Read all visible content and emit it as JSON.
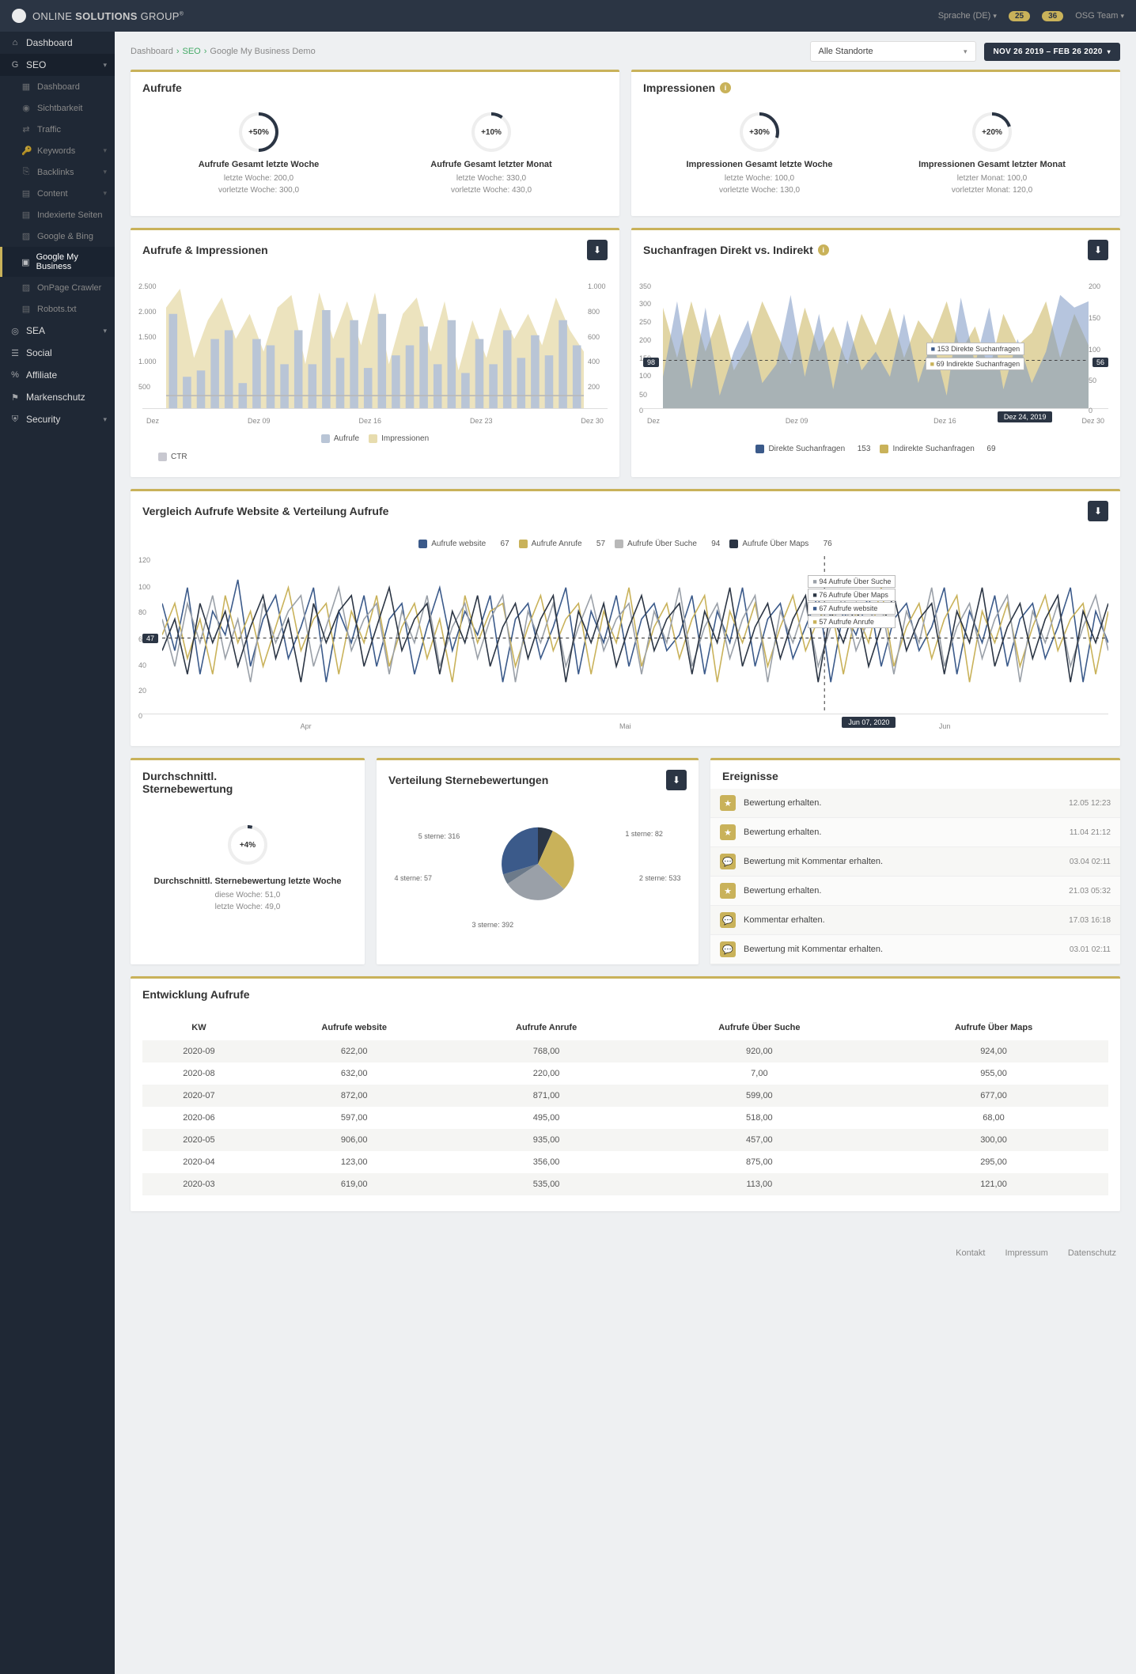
{
  "brand": {
    "name_pre": "ONLINE ",
    "name_bold": "SOLUTIONS ",
    "name_post": "GROUP",
    "reg": "®"
  },
  "topbar": {
    "lang": "Sprache (DE)",
    "badge1": "25",
    "badge2": "36",
    "user": "OSG Team"
  },
  "sidebar": {
    "dashboard": "Dashboard",
    "seo": "SEO",
    "seo_items": [
      "Dashboard",
      "Sichtbarkeit",
      "Traffic",
      "Keywords",
      "Backlinks",
      "Content",
      "Indexierte Seiten",
      "Google & Bing",
      "Google My Business",
      "OnPage Crawler",
      "Robots.txt"
    ],
    "sea": "SEA",
    "social": "Social",
    "affiliate": "Affiliate",
    "marken": "Markenschutz",
    "security": "Security"
  },
  "breadcrumb": {
    "a": "Dashboard",
    "b": "SEO",
    "c": "Google My Business Demo"
  },
  "loc_select": "Alle Standorte",
  "date_range": "NOV 26 2019 – FEB 26 2020",
  "card_aufrufe": {
    "title": "Aufrufe",
    "k1": {
      "pct": "+50%",
      "title": "Aufrufe Gesamt letzte Woche",
      "l1": "letzte Woche: 200,0",
      "l2": "vorletzte Woche: 300,0"
    },
    "k2": {
      "pct": "+10%",
      "title": "Aufrufe Gesamt letzter Monat",
      "l1": "letzte Woche: 330,0",
      "l2": "vorletzte Woche: 430,0"
    }
  },
  "card_impr": {
    "title": "Impressionen",
    "k1": {
      "pct": "+30%",
      "title": "Impressionen Gesamt letzte Woche",
      "l1": "letzte Woche: 100,0",
      "l2": "vorletzte Woche: 130,0"
    },
    "k2": {
      "pct": "+20%",
      "title": "Impressionen Gesamt letzter Monat",
      "l1": "letzter Monat: 100,0",
      "l2": "vorletzter Monat: 120,0"
    }
  },
  "card_ai": {
    "title": "Aufrufe & Impressionen",
    "legend": {
      "a": "Aufrufe",
      "b": "Impressionen",
      "c": "CTR"
    },
    "xticks": [
      "Dez",
      "Dez 09",
      "Dez 16",
      "Dez 23",
      "Dez 30"
    ]
  },
  "card_such": {
    "title": "Suchanfragen Direkt vs. Indirekt",
    "tt1": "153 Direkte Suchanfragen",
    "tt2": "69 Indirekte Suchanfragen",
    "lbadge": "98",
    "rbadge": "56",
    "datebadge": "Dez 24, 2019",
    "legend": {
      "a": "Direkte Suchanfragen",
      "av": "153",
      "b": "Indirekte Suchanfragen",
      "bv": "69"
    },
    "xticks": [
      "Dez",
      "Dez 09",
      "Dez 16",
      "Dez 30"
    ]
  },
  "card_vgl": {
    "title": "Vergleich Aufrufe Website & Verteilung Aufrufe",
    "legend": {
      "a": "Aufrufe website",
      "av": "67",
      "b": "Aufrufe Anrufe",
      "bv": "57",
      "c": "Aufrufe Über Suche",
      "cv": "94",
      "d": "Aufrufe Über Maps",
      "dv": "76"
    },
    "tt": [
      "94 Aufrufe Über Suche",
      "76 Aufrufe Über Maps",
      "67 Aufrufe website",
      "57 Aufrufe Anrufe"
    ],
    "lbadge": "47",
    "datebadge": "Jun 07, 2020",
    "xticks": [
      "Apr",
      "Mai",
      "Jun"
    ]
  },
  "card_durch": {
    "title1": "Durchschnittl.",
    "title2": "Sternebewertung",
    "pct": "+4%",
    "sub_title": "Durchschnittl. Sternebewertung letzte Woche",
    "l1": "diese Woche: 51,0",
    "l2": "letzte Woche: 49,0"
  },
  "card_pie": {
    "title": "Verteilung Sternebewertungen",
    "labels": {
      "s1": "1 sterne: 82",
      "s2": "2 sterne: 533",
      "s3": "3 sterne: 392",
      "s4": "4 sterne: 57",
      "s5": "5 sterne: 316"
    }
  },
  "card_events": {
    "title": "Ereignisse",
    "rows": [
      {
        "ico": "star",
        "txt": "Bewertung erhalten.",
        "ts": "12.05 12:23"
      },
      {
        "ico": "star",
        "txt": "Bewertung erhalten.",
        "ts": "11.04 21:12"
      },
      {
        "ico": "chat",
        "txt": "Bewertung mit Kommentar erhalten.",
        "ts": "03.04 02:11"
      },
      {
        "ico": "star",
        "txt": "Bewertung erhalten.",
        "ts": "21.03 05:32"
      },
      {
        "ico": "chat",
        "txt": "Kommentar erhalten.",
        "ts": "17.03 16:18"
      },
      {
        "ico": "chat",
        "txt": "Bewertung mit Kommentar erhalten.",
        "ts": "03.01 02:11"
      }
    ]
  },
  "card_table": {
    "title": "Entwicklung Aufrufe",
    "headers": [
      "KW",
      "Aufrufe website",
      "Aufrufe Anrufe",
      "Aufrufe Über Suche",
      "Aufrufe Über Maps"
    ],
    "rows": [
      [
        "2020-09",
        "622,00",
        "768,00",
        "920,00",
        "924,00"
      ],
      [
        "2020-08",
        "632,00",
        "220,00",
        "7,00",
        "955,00"
      ],
      [
        "2020-07",
        "872,00",
        "871,00",
        "599,00",
        "677,00"
      ],
      [
        "2020-06",
        "597,00",
        "495,00",
        "518,00",
        "68,00"
      ],
      [
        "2020-05",
        "906,00",
        "935,00",
        "457,00",
        "300,00"
      ],
      [
        "2020-04",
        "123,00",
        "356,00",
        "875,00",
        "295,00"
      ],
      [
        "2020-03",
        "619,00",
        "535,00",
        "113,00",
        "121,00"
      ]
    ]
  },
  "footer": {
    "a": "Kontakt",
    "b": "Impressum",
    "c": "Datenschutz"
  },
  "colors": {
    "gold": "#c9b25a",
    "navy": "#2b3544",
    "blue": "#3b5a8a",
    "lgrey": "#b8b8b8"
  },
  "chart_data": [
    {
      "id": "aufrufe_impressionen",
      "type": "bar+line",
      "x_ticks": [
        "Dez",
        "Dez 09",
        "Dez 16",
        "Dez 23",
        "Dez 30"
      ],
      "y_left": {
        "label": "",
        "range": [
          0,
          2500
        ],
        "ticks": [
          0,
          500,
          1000,
          1500,
          2000,
          2500
        ]
      },
      "y_right": {
        "label": "",
        "range": [
          0,
          1000
        ],
        "ticks": [
          0,
          200,
          400,
          600,
          800,
          1000
        ]
      },
      "series": [
        {
          "name": "Aufrufe",
          "axis": "left",
          "type": "bar",
          "color": "#b9c5d6",
          "values": [
            1900,
            600,
            700,
            1400,
            1600,
            500,
            1400,
            1300,
            900,
            1600,
            900,
            2000,
            1000,
            1800,
            800,
            1900,
            1100,
            1300,
            1700,
            900,
            1800,
            700,
            1400,
            900,
            1600,
            1000,
            1500,
            1100,
            1800,
            1300,
            900
          ]
        },
        {
          "name": "Impressionen",
          "axis": "left",
          "type": "area",
          "color": "#e7dcae",
          "values": [
            2000,
            2400,
            1100,
            1700,
            2200,
            1300,
            1800,
            1200,
            1900,
            2200,
            1000,
            2300,
            1400,
            2100,
            1300,
            2300,
            1000,
            1800,
            2200,
            1200,
            2100,
            900,
            1700,
            1100,
            2000,
            1400,
            1800,
            1300,
            2200,
            1600,
            1200
          ]
        },
        {
          "name": "CTR",
          "axis": "right",
          "type": "line",
          "color": "#b8b8b8",
          "values": [
            100,
            100,
            100,
            100,
            100,
            100,
            100,
            100,
            100,
            100,
            100,
            100,
            100,
            100,
            100,
            100,
            100,
            100,
            100,
            100,
            100,
            100,
            100,
            100,
            100,
            100,
            100,
            100,
            100,
            100,
            100
          ]
        }
      ]
    },
    {
      "id": "suchanfragen",
      "type": "area",
      "x_ticks": [
        "Dez",
        "Dez 09",
        "Dez 16",
        "Dez 24",
        "Dez 30"
      ],
      "y_left": {
        "range": [
          0,
          350
        ],
        "ticks": [
          0,
          50,
          100,
          150,
          200,
          250,
          300,
          350
        ]
      },
      "y_right": {
        "range": [
          0,
          200
        ],
        "ticks": [
          0,
          50,
          100,
          150,
          200
        ]
      },
      "tooltip_date": "Dez 24, 2019",
      "series": [
        {
          "name": "Direkte Suchanfragen",
          "color": "#3b5a8a",
          "tooltip_value": 153,
          "axis_badge": 98,
          "values": [
            90,
            300,
            60,
            280,
            40,
            150,
            250,
            80,
            120,
            320,
            90,
            270,
            60,
            250,
            100,
            150,
            90,
            260,
            70,
            200,
            50,
            310,
            120,
            290,
            60,
            200,
            80,
            150,
            320,
            280,
            300
          ]
        },
        {
          "name": "Indirekte Suchanfragen",
          "color": "#c9b25a",
          "tooltip_value": 69,
          "axis_badge": 56,
          "values": [
            160,
            80,
            170,
            90,
            150,
            60,
            100,
            170,
            120,
            70,
            160,
            90,
            130,
            70,
            150,
            100,
            160,
            80,
            140,
            110,
            170,
            90,
            130,
            60,
            150,
            100,
            120,
            170,
            80,
            150,
            100
          ]
        }
      ]
    },
    {
      "id": "vergleich_aufrufe",
      "type": "line",
      "x_ticks": [
        "Apr",
        "Mai",
        "Jun"
      ],
      "y_left": {
        "range": [
          0,
          120
        ],
        "ticks": [
          0,
          20,
          40,
          60,
          80,
          100,
          120
        ]
      },
      "tooltip_date": "Jun 07, 2020",
      "axis_badge_left": 47,
      "series": [
        {
          "name": "Aufrufe website",
          "color": "#3b5a8a",
          "legend_value": 67,
          "tooltip_value": 67
        },
        {
          "name": "Aufrufe Anrufe",
          "color": "#c9b25a",
          "legend_value": 57,
          "tooltip_value": 57
        },
        {
          "name": "Aufrufe Über Suche",
          "color": "#9aa0a8",
          "legend_value": 94,
          "tooltip_value": 94
        },
        {
          "name": "Aufrufe Über Maps",
          "color": "#2b3544",
          "legend_value": 76,
          "tooltip_value": 76
        }
      ],
      "note": "dense daily values ~0–100, estimated"
    },
    {
      "id": "sternebewertungen",
      "type": "pie",
      "title": "Verteilung Sternebewertungen",
      "slices": [
        {
          "name": "1 sterne",
          "value": 82,
          "color": "#2b3544"
        },
        {
          "name": "2 sterne",
          "value": 533,
          "color": "#c9b25a"
        },
        {
          "name": "3 sterne",
          "value": 392,
          "color": "#9aa0a8"
        },
        {
          "name": "4 sterne",
          "value": 57,
          "color": "#6c7a8a"
        },
        {
          "name": "5 sterne",
          "value": 316,
          "color": "#3b5a8a"
        }
      ]
    },
    {
      "id": "entwicklung_aufrufe",
      "type": "table",
      "columns": [
        "KW",
        "Aufrufe website",
        "Aufrufe Anrufe",
        "Aufrufe Über Suche",
        "Aufrufe Über Maps"
      ],
      "rows": [
        [
          "2020-09",
          622,
          768,
          920,
          924
        ],
        [
          "2020-08",
          632,
          220,
          7,
          955
        ],
        [
          "2020-07",
          872,
          871,
          599,
          677
        ],
        [
          "2020-06",
          597,
          495,
          518,
          68
        ],
        [
          "2020-05",
          906,
          935,
          457,
          300
        ],
        [
          "2020-04",
          123,
          356,
          875,
          295
        ],
        [
          "2020-03",
          619,
          535,
          113,
          121
        ]
      ]
    }
  ]
}
